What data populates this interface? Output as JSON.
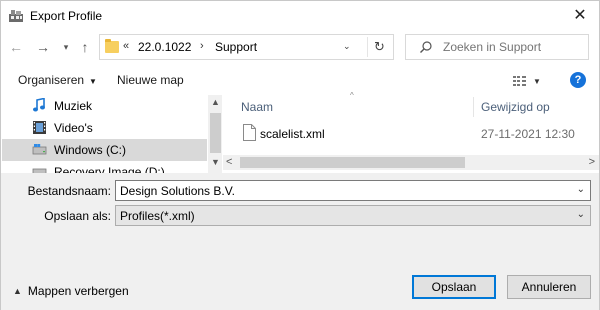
{
  "window": {
    "title": "Export Profile",
    "close_glyph": "✕"
  },
  "navigation": {
    "back_glyph": "←",
    "forward_glyph": "→",
    "recent_glyph": "▾",
    "up_glyph": "↑"
  },
  "address": {
    "overflow_glyph": "«",
    "segments": [
      "22.0.1022",
      "Support"
    ],
    "separator": "›",
    "dropdown_glyph": "⌄",
    "refresh_glyph": "↻"
  },
  "search": {
    "placeholder": "Zoeken in Support"
  },
  "toolbar": {
    "organize_label": "Organiseren",
    "organize_caret": "▼",
    "new_folder_label": "Nieuwe map",
    "view_caret": "▼",
    "help_label": "?"
  },
  "nav_pane": {
    "items": [
      {
        "label": "Muziek",
        "icon": "music-icon",
        "selected": false
      },
      {
        "label": "Video's",
        "icon": "video-icon",
        "selected": false
      },
      {
        "label": "Windows (C:)",
        "icon": "drive-icon",
        "selected": true
      },
      {
        "label": "Recovery Image (D:)",
        "icon": "drive-icon",
        "selected": false
      }
    ],
    "scroll_up_glyph": "▲",
    "scroll_down_glyph": "▼"
  },
  "file_list": {
    "columns": {
      "name": "Naam",
      "modified": "Gewijzigd op",
      "sort_glyph": "^"
    },
    "files": [
      {
        "name": "scalelist.xml",
        "modified": "27-11-2021 12:30"
      }
    ],
    "scroll_left_glyph": "<",
    "scroll_right_glyph": ">"
  },
  "form": {
    "filename_label": "Bestandsnaam:",
    "filename_value": "Design Solutions B.V.",
    "saveas_label": "Opslaan als:",
    "saveas_value": "Profiles(*.xml)",
    "caret_glyph": "⌄"
  },
  "footer": {
    "hide_folders_label": "Mappen verbergen",
    "hide_caret": "▲",
    "save_label": "Opslaan",
    "cancel_label": "Annuleren"
  },
  "colors": {
    "accent": "#0078d7",
    "help_blue": "#1672d9",
    "folder_yellow": "#f7cf5f",
    "column_header": "#4c607a"
  }
}
